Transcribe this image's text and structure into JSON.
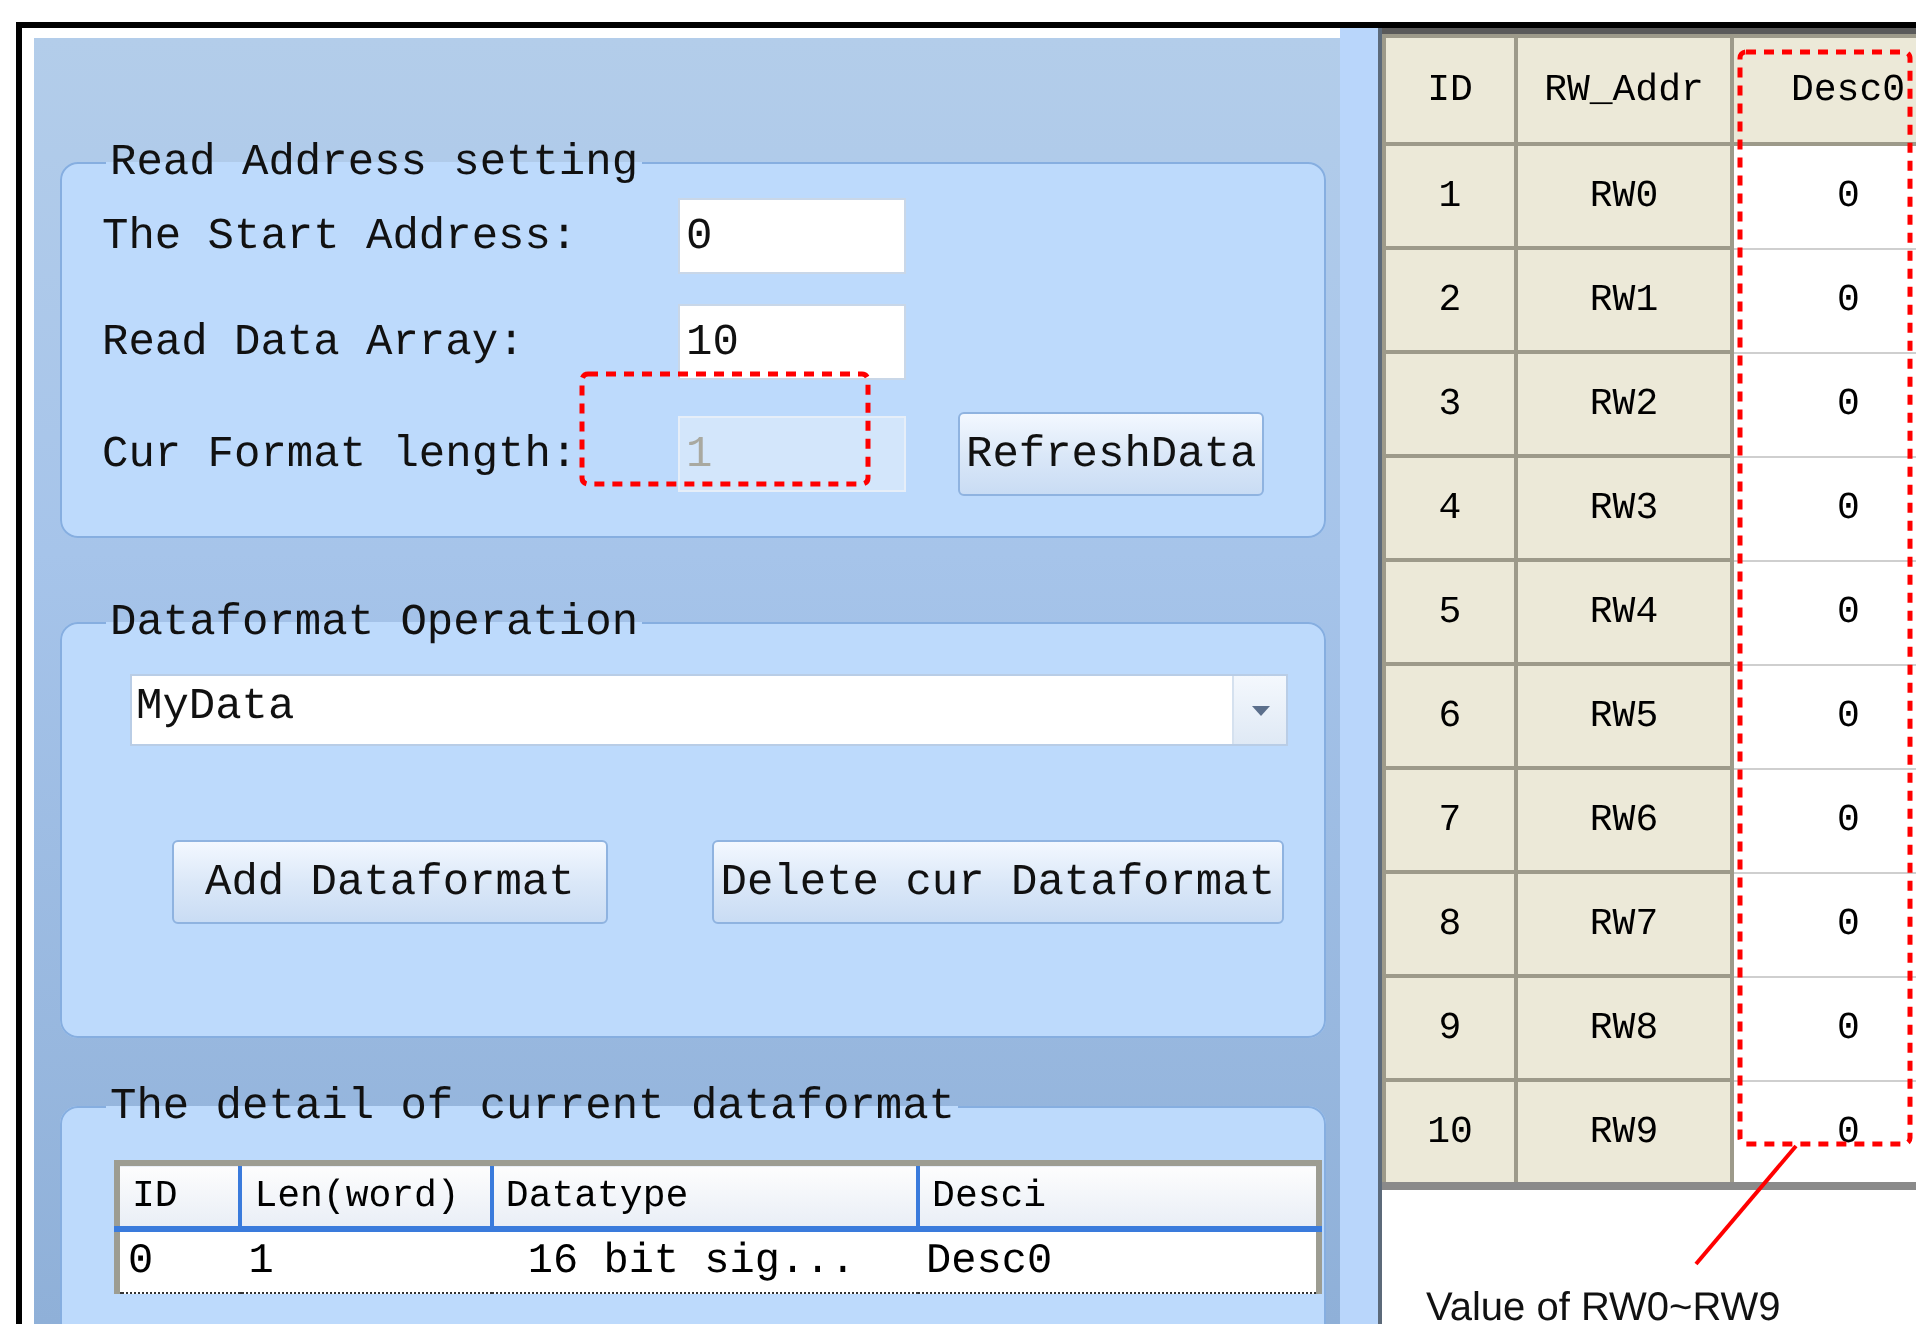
{
  "read_address": {
    "title": "Read Address setting",
    "fields": [
      {
        "label": "The Start Address:",
        "value": "0",
        "disabled": false
      },
      {
        "label": "Read Data Array:",
        "value": "10",
        "disabled": false
      },
      {
        "label": "Cur Format length:",
        "value": "1",
        "disabled": true
      }
    ],
    "refresh_button": "RefreshData"
  },
  "dataformat_operation": {
    "title": "Dataformat Operation",
    "combo_value": "MyData",
    "buttons": [
      "Add Dataformat",
      "Delete cur Dataformat"
    ]
  },
  "current_dataformat": {
    "title": "The detail of current dataformat",
    "columns": [
      "ID",
      "Len(word)",
      "Datatype",
      "Desci"
    ],
    "rows": [
      {
        "cells": [
          "0",
          "1",
          "16 bit sig...",
          "Desc0"
        ],
        "selected": true
      }
    ]
  },
  "value_grid": {
    "columns": [
      "ID",
      "RW_Addr",
      "Desc0"
    ],
    "rows": [
      [
        "1",
        "RW0",
        "0"
      ],
      [
        "2",
        "RW1",
        "0"
      ],
      [
        "3",
        "RW2",
        "0"
      ],
      [
        "4",
        "RW3",
        "0"
      ],
      [
        "5",
        "RW4",
        "0"
      ],
      [
        "6",
        "RW5",
        "0"
      ],
      [
        "7",
        "RW6",
        "0"
      ],
      [
        "8",
        "RW7",
        "0"
      ],
      [
        "9",
        "RW8",
        "0"
      ],
      [
        "10",
        "RW9",
        "0"
      ]
    ]
  },
  "annotation": {
    "text": "Value of RW0~RW9"
  }
}
